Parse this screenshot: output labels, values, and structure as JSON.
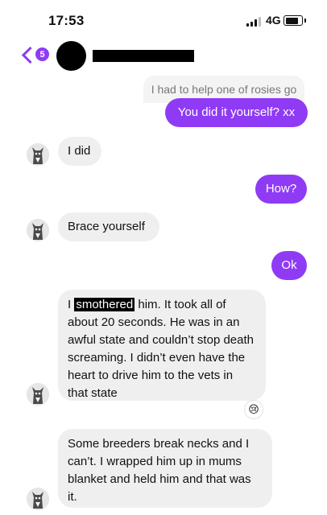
{
  "status_bar": {
    "time": "17:53",
    "network": "4G"
  },
  "header": {
    "back_badge_count": "5",
    "accent_color": "#8f3bf5"
  },
  "messages": [
    {
      "id": "quote",
      "direction": "out-reply-quote",
      "text": "I had to help one of rosies go"
    },
    {
      "id": "m1",
      "direction": "out",
      "text": "You did it yourself? xx"
    },
    {
      "id": "m2",
      "direction": "in",
      "text": "I did"
    },
    {
      "id": "m3",
      "direction": "out",
      "text": "How?"
    },
    {
      "id": "m4",
      "direction": "in",
      "text": "Brace yourself"
    },
    {
      "id": "m5",
      "direction": "out",
      "text": "Ok"
    },
    {
      "id": "m6",
      "direction": "in",
      "text_before": "I ",
      "redacted_word": "smothered",
      "text_after": " him. It took all of about 20 seconds. He was in an awful state and couldn’t stop death screaming. I didn’t even have the heart to drive him to the vets in that state",
      "reaction": "😢"
    },
    {
      "id": "m7",
      "direction": "in",
      "text": "Some breeders break necks and I can’t. I wrapped him up in mums blanket and held him and that was it."
    }
  ],
  "icons": {
    "back": "chevron-left-icon",
    "avatar": "cat-avatar-icon",
    "reaction": "crying-face-emoji"
  }
}
